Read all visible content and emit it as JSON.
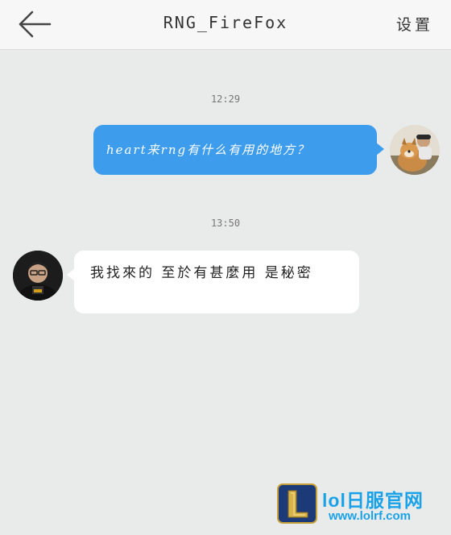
{
  "header": {
    "back_icon": "arrow-left-icon",
    "title": "RNG_FireFox",
    "settings_label": "设置"
  },
  "messages": [
    {
      "time": "12:29",
      "direction": "outgoing",
      "text": "heart来rng有什么有用的地方？",
      "bubble_color": "#3d9cec"
    },
    {
      "time": "13:50",
      "direction": "incoming",
      "text": "我找來的 至於有甚麼用 是秘密",
      "bubble_color": "#ffffff"
    }
  ],
  "watermark": {
    "site_name": "lol日服官网",
    "url": "www.lolrf.com",
    "color": "#1aa2e8"
  },
  "colors": {
    "background": "#e9ebea",
    "topbar": "#f7f7f7",
    "accent": "#3d9cec"
  }
}
